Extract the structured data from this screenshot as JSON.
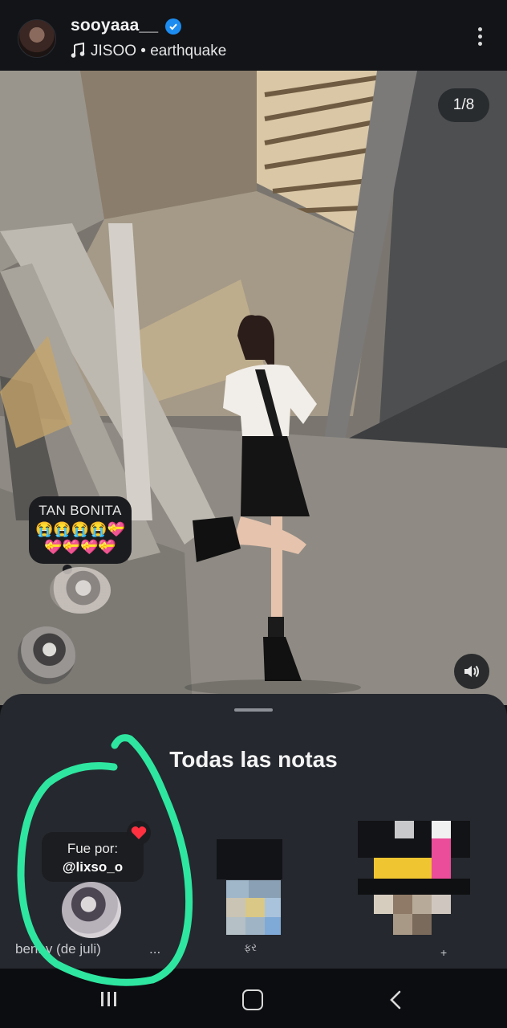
{
  "header": {
    "username": "sooyaaa__",
    "song": "JISOO • earthquake",
    "icons": {
      "verified": "verified-badge-icon",
      "music": "music-note-icon",
      "more": "more-options-icon"
    }
  },
  "post": {
    "counter": "1/8",
    "note_bubble": {
      "text": "TAN BONITA",
      "emojis": "😭😭😭😭💝\n💝💝💝💝"
    }
  },
  "notes_sheet": {
    "title": "Todas las notas",
    "items": [
      {
        "tooltip_line1": "Fue por:",
        "tooltip_line2": "@lixso_o",
        "label": "benny (de juli)",
        "more": "..."
      },
      {
        "label": "ફર"
      },
      {
        "label": "+"
      }
    ]
  },
  "colors": {
    "annotation": "#2ee6a0",
    "accent": "#1d8cf0",
    "heart": "#ff3040"
  }
}
